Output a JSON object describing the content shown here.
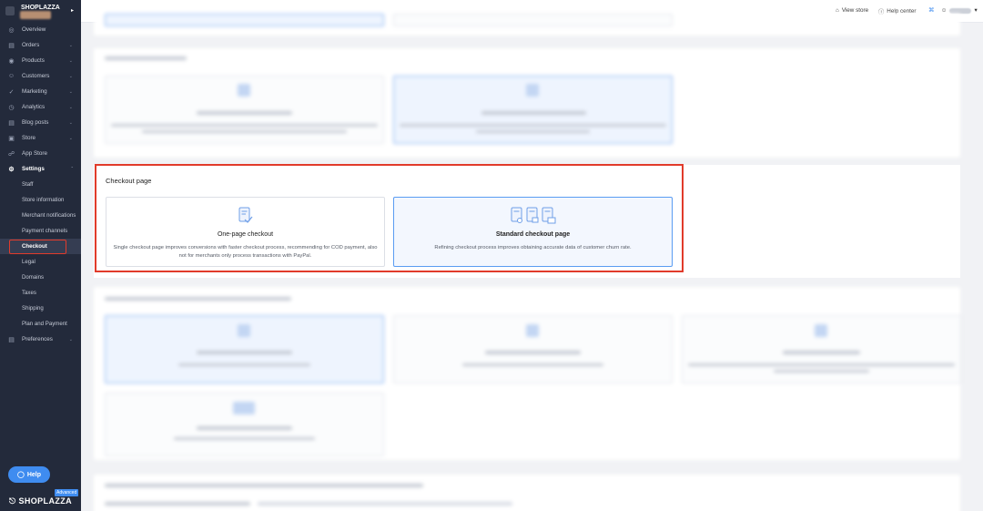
{
  "sidebar": {
    "brand": "SHOPLAZZA",
    "items": [
      {
        "label": "Overview",
        "icon": "overview-icon",
        "chevron": false
      },
      {
        "label": "Orders",
        "icon": "orders-icon",
        "chevron": true
      },
      {
        "label": "Products",
        "icon": "products-icon",
        "chevron": true
      },
      {
        "label": "Customers",
        "icon": "customers-icon",
        "chevron": true
      },
      {
        "label": "Marketing",
        "icon": "marketing-icon",
        "chevron": true
      },
      {
        "label": "Analytics",
        "icon": "analytics-icon",
        "chevron": true
      },
      {
        "label": "Blog posts",
        "icon": "blog-icon",
        "chevron": true
      },
      {
        "label": "Store",
        "icon": "store-icon",
        "chevron": true
      },
      {
        "label": "App Store",
        "icon": "app-store-icon",
        "chevron": false
      },
      {
        "label": "Settings",
        "icon": "gear-icon",
        "chevron": true
      }
    ],
    "settings_sub": [
      "Staff",
      "Store information",
      "Merchant notifications",
      "Payment channels",
      "Checkout",
      "Legal",
      "Domains",
      "Taxes",
      "Shipping",
      "Plan and Payment"
    ],
    "preferences": "Preferences",
    "help_label": "Help",
    "advanced_label": "Advanced",
    "bottom_brand": "SHOPLAZZA"
  },
  "topbar": {
    "view_store": "View store",
    "help_center": "Help center"
  },
  "checkout": {
    "title": "Checkout page",
    "options": [
      {
        "title": "One-page checkout",
        "desc": "Single checkout page improves conversions with faster checkout process, recommending for COD payment, also not for merchants only process transactions with PayPal.",
        "selected": false
      },
      {
        "title": "Standard checkout page",
        "desc": "Refining checkout process improves obtaining accurate data of customer churn rate.",
        "selected": true
      }
    ]
  },
  "colors": {
    "sidebar_bg": "#232a3b",
    "accent": "#3f8cf0",
    "highlight": "#e13b2b"
  }
}
